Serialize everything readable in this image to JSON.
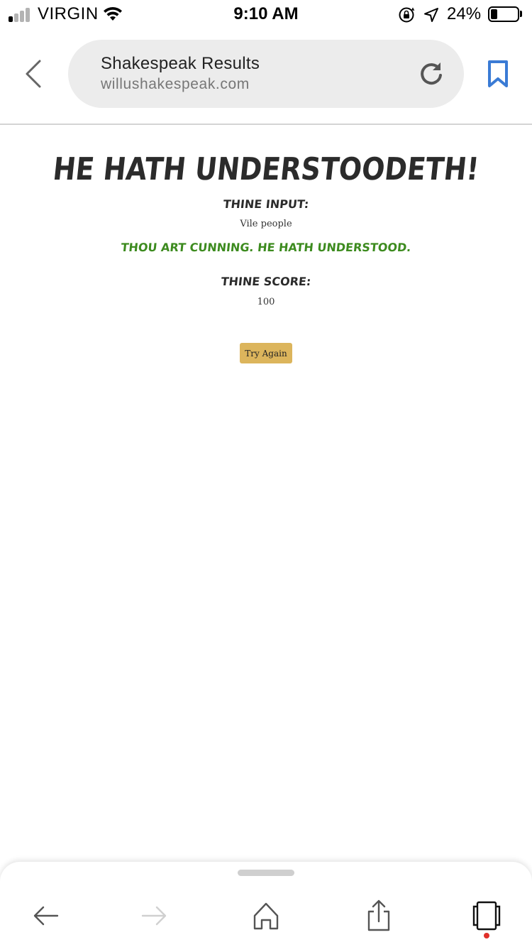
{
  "status_bar": {
    "carrier": "VIRGIN",
    "time": "9:10 AM",
    "battery_percent_text": "24%",
    "battery_level": 0.24,
    "signal_bars_active": 1,
    "signal_bars_total": 4
  },
  "browser": {
    "page_title": "Shakespeak Results",
    "domain": "willushakespeak.com",
    "accent_color": "#3a7bd5"
  },
  "page": {
    "headline": "He hath understoodeth!",
    "input_label": "Thine input:",
    "input_value": "Vile people",
    "verdict": "Thou art cunning. He hath understood.",
    "verdict_color": "#3d8b1f",
    "score_label": "Thine score:",
    "score_value": "100",
    "try_again_label": "Try Again",
    "button_color": "#dcb55c"
  },
  "toolbar": {
    "icons": [
      "back-arrow-icon",
      "forward-arrow-icon",
      "home-icon",
      "share-icon",
      "tabs-icon"
    ],
    "notification_dot_color": "#e0302a"
  }
}
